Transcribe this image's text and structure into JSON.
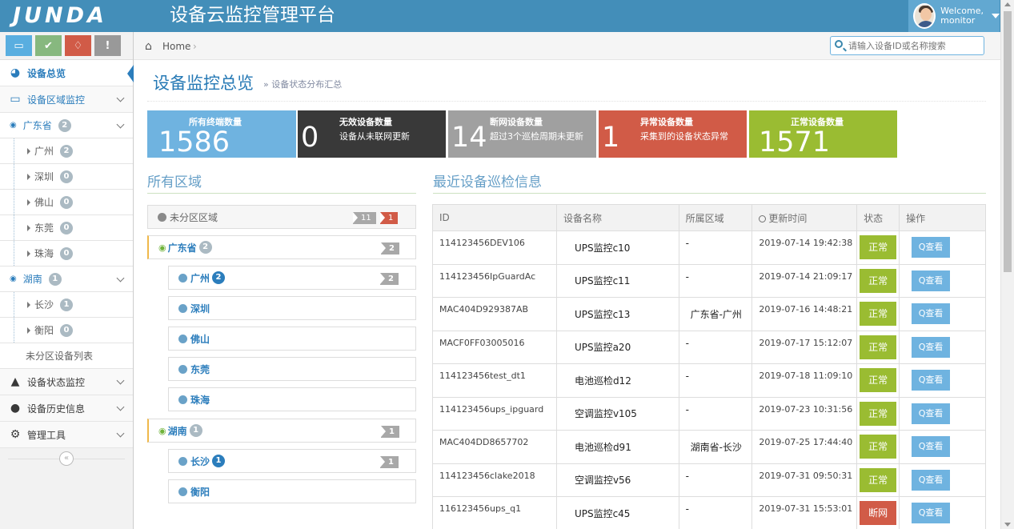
{
  "header": {
    "logo_text": "JUNDA",
    "app_title": "设备云监控管理平台",
    "welcome": "Welcome,",
    "username": "monitor"
  },
  "shortcuts": [
    {
      "icon": "monitor-icon",
      "glyph": "▭",
      "color": "#59aee0"
    },
    {
      "icon": "check-icon",
      "glyph": "✔",
      "color": "#87b87f"
    },
    {
      "icon": "bell-icon",
      "glyph": "♢",
      "color": "#d15b47"
    },
    {
      "icon": "info-icon",
      "glyph": "!",
      "color": "#999999"
    }
  ],
  "sidebar": {
    "overview": "设备总览",
    "region_monitor": "设备区域监控",
    "guangdong": {
      "label": "广东省",
      "count": "2"
    },
    "guangdong_cities": [
      {
        "label": "广州",
        "count": "2"
      },
      {
        "label": "深圳",
        "count": "0"
      },
      {
        "label": "佛山",
        "count": "0"
      },
      {
        "label": "东莞",
        "count": "0"
      },
      {
        "label": "珠海",
        "count": "0"
      }
    ],
    "hunan": {
      "label": "湖南",
      "count": "1"
    },
    "hunan_cities": [
      {
        "label": "长沙",
        "count": "1"
      },
      {
        "label": "衡阳",
        "count": "0"
      }
    ],
    "unassigned_list": "未分区设备列表",
    "status_monitor": "设备状态监控",
    "history": "设备历史信息",
    "admin_tools": "管理工具",
    "collapse_glyph": "«"
  },
  "breadcrumb": {
    "home": "Home",
    "sep": "›"
  },
  "search": {
    "placeholder": "请输入设备ID或名称搜索"
  },
  "page": {
    "title": "设备监控总览",
    "subtitle": "» 设备状态分布汇总"
  },
  "stats": [
    {
      "title": "所有终端数量",
      "desc": "",
      "value": "1586",
      "color": "#6fb3e0"
    },
    {
      "title": "无效设备数量",
      "desc": "设备从未联网更新",
      "value": "0",
      "color": "#393939"
    },
    {
      "title": "断网设备数量",
      "desc": "超过3个巡检周期未更新",
      "value": "14",
      "color": "#a0a0a0"
    },
    {
      "title": "异常设备数量",
      "desc": "采集到的设备状态异常",
      "value": "1",
      "color": "#d15b47"
    },
    {
      "title": "正常设备数量",
      "desc": "",
      "value": "1571",
      "color": "#9abc32"
    }
  ],
  "regions": {
    "heading": "所有区域",
    "unassigned": {
      "label": "未分区区域",
      "tag_gray": "11",
      "tag_red": "1"
    },
    "guangdong": {
      "label": "广东省",
      "badge": "2",
      "tag": "2"
    },
    "guangzhou": {
      "label": "广州",
      "badge": "2",
      "tag": "2"
    },
    "shenzhen": "深圳",
    "foshan": "佛山",
    "dongguan": "东莞",
    "zhuhai": "珠海",
    "hunan": {
      "label": "湖南",
      "badge": "1",
      "tag": "1"
    },
    "changsha": {
      "label": "长沙",
      "badge": "1",
      "tag": "1"
    },
    "hengyang": "衡阳"
  },
  "inspection": {
    "heading": "最近设备巡检信息",
    "columns": [
      "ID",
      "设备名称",
      "所属区域",
      "更新时间",
      "状态",
      "操作"
    ],
    "view_label": "Q查看",
    "status_colors": {
      "正常": "#87b87f",
      "断网": "#d15b47"
    },
    "status_colors_alt": {
      "正常": "#9abc32"
    },
    "rows": [
      {
        "id": "114123456DEV106",
        "name": "UPS监控c10",
        "area": "-",
        "time": "2019-07-14 19:42:38",
        "status": "正常"
      },
      {
        "id": "114123456IpGuardAc",
        "name": "UPS监控c11",
        "area": "-",
        "time": "2019-07-14 21:09:17",
        "status": "正常"
      },
      {
        "id": "MAC404D929387AB",
        "name": "UPS监控c13",
        "area": "广东省-广州",
        "time": "2019-07-16 14:48:21",
        "status": "正常"
      },
      {
        "id": "MACF0FF03005016",
        "name": "UPS监控a20",
        "area": "-",
        "time": "2019-07-17 15:12:07",
        "status": "正常"
      },
      {
        "id": "114123456test_dt1",
        "name": "电池巡检d12",
        "area": "-",
        "time": "2019-07-18 11:09:10",
        "status": "正常"
      },
      {
        "id": "114123456ups_ipguard",
        "name": "空调监控v105",
        "area": "-",
        "time": "2019-07-23 10:31:56",
        "status": "正常"
      },
      {
        "id": "MAC404DD8657702",
        "name": "电池巡检d91",
        "area": "湖南省-长沙",
        "time": "2019-07-25 17:44:40",
        "status": "正常"
      },
      {
        "id": "114123456clake2018",
        "name": "空调监控v56",
        "area": "-",
        "time": "2019-07-31 09:50:31",
        "status": "正常"
      },
      {
        "id": "116123456ups_q1",
        "name": "UPS监控c45",
        "area": "-",
        "time": "2019-07-31 15:53:01",
        "status": "断网"
      }
    ]
  }
}
